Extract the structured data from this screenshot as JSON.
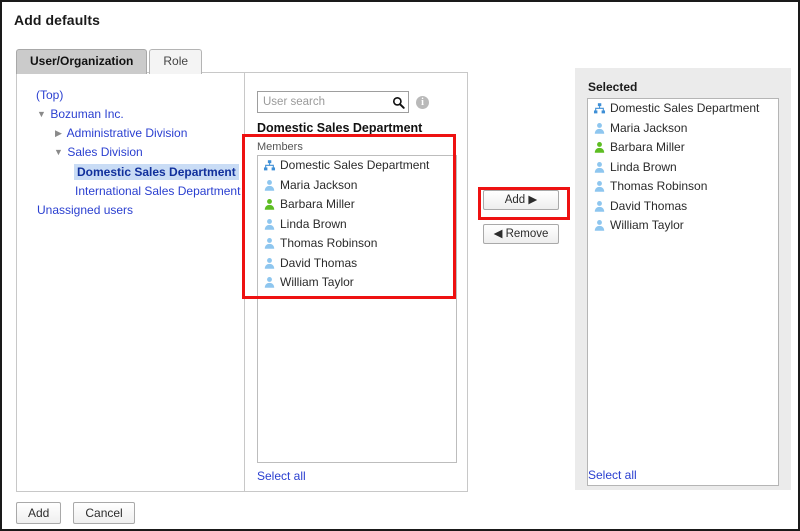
{
  "page": {
    "title": "Add defaults"
  },
  "tabs": [
    {
      "label": "User/Organization",
      "active": true
    },
    {
      "label": "Role",
      "active": false
    }
  ],
  "tree": [
    {
      "label": "(Top)",
      "indent": 0,
      "twisty": "none",
      "selected": false
    },
    {
      "label": "Bozuman Inc.",
      "indent": 1,
      "twisty": "open",
      "selected": false
    },
    {
      "label": "Administrative Division",
      "indent": 2,
      "twisty": "closed",
      "selected": false
    },
    {
      "label": "Sales Division",
      "indent": 2,
      "twisty": "open",
      "selected": false
    },
    {
      "label": "Domestic Sales Department",
      "indent": 3,
      "twisty": "none",
      "selected": true
    },
    {
      "label": "International Sales Department",
      "indent": 3,
      "twisty": "none",
      "selected": false
    },
    {
      "label": "Unassigned users",
      "indent": 1,
      "twisty": "none",
      "selected": false
    }
  ],
  "search": {
    "value": "",
    "placeholder": "User search",
    "icon": "search-icon",
    "info_icon": "info-icon",
    "info_glyph": "i"
  },
  "middle": {
    "organization_heading": "Domestic Sales Department",
    "members_caption": "Members",
    "select_all_label": "Select all",
    "members": [
      {
        "label": "Domestic Sales Department",
        "icon": "organization-icon",
        "color": "#3e8fd6"
      },
      {
        "label": "Maria Jackson",
        "icon": "user-icon",
        "color": "#8ec6ef"
      },
      {
        "label": "Barbara Miller",
        "icon": "user-icon-active",
        "color": "#5dbd22"
      },
      {
        "label": "Linda Brown",
        "icon": "user-icon",
        "color": "#8ec6ef"
      },
      {
        "label": "Thomas Robinson",
        "icon": "user-icon",
        "color": "#8ec6ef"
      },
      {
        "label": "David Thomas",
        "icon": "user-icon",
        "color": "#8ec6ef"
      },
      {
        "label": "William Taylor",
        "icon": "user-icon",
        "color": "#8ec6ef"
      }
    ]
  },
  "transfer": {
    "add_label": "Add ▶",
    "remove_label": "◀ Remove"
  },
  "selected": {
    "title": "Selected",
    "select_all_label": "Select all",
    "items": [
      {
        "label": "Domestic Sales Department",
        "icon": "organization-icon",
        "color": "#3e8fd6"
      },
      {
        "label": "Maria Jackson",
        "icon": "user-icon",
        "color": "#8ec6ef"
      },
      {
        "label": "Barbara Miller",
        "icon": "user-icon-active",
        "color": "#5dbd22"
      },
      {
        "label": "Linda Brown",
        "icon": "user-icon",
        "color": "#8ec6ef"
      },
      {
        "label": "Thomas Robinson",
        "icon": "user-icon",
        "color": "#8ec6ef"
      },
      {
        "label": "David Thomas",
        "icon": "user-icon",
        "color": "#8ec6ef"
      },
      {
        "label": "William Taylor",
        "icon": "user-icon",
        "color": "#8ec6ef"
      }
    ]
  },
  "footer": {
    "add_label": "Add",
    "cancel_label": "Cancel"
  },
  "annotations": {
    "highlight_color": "#ee1111",
    "boxes": [
      "members-list",
      "add-button"
    ]
  }
}
